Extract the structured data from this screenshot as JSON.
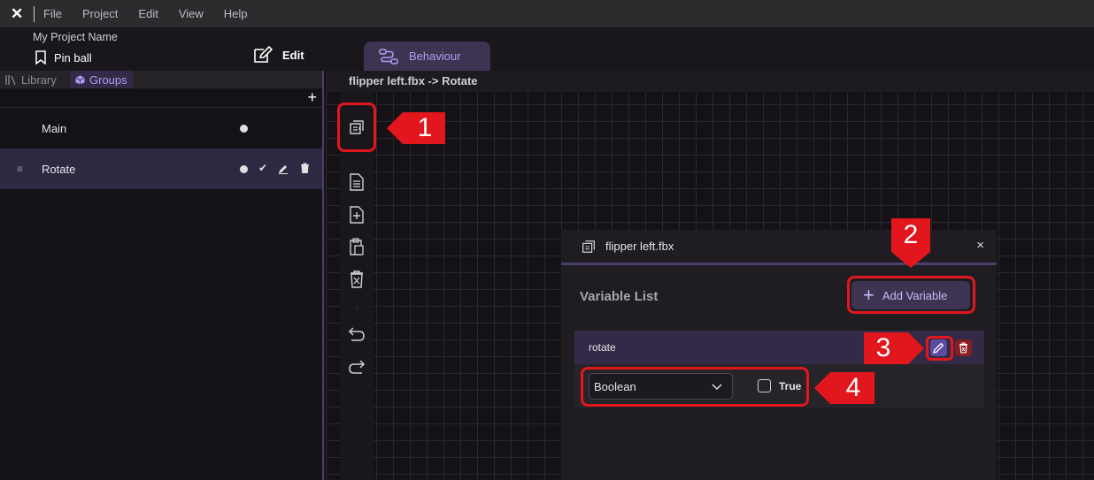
{
  "menu": {
    "logo_icon": "app-logo-icon",
    "items": [
      "File",
      "Project",
      "Edit",
      "View",
      "Help"
    ]
  },
  "header": {
    "project_name": "My Project Name",
    "file_name": "Pin ball",
    "edit_tab": "Edit",
    "behaviour_tab": "Behaviour"
  },
  "left_panel": {
    "tabs": {
      "library": "Library",
      "groups": "Groups"
    },
    "groups": [
      {
        "label": "Main"
      },
      {
        "label": "Rotate"
      }
    ]
  },
  "canvas": {
    "breadcrumb": "flipper left.fbx -> Rotate"
  },
  "dialog": {
    "title": "flipper left.fbx",
    "close_label": "×",
    "section_title": "Variable List",
    "add_variable_label": "Add Variable",
    "variable": {
      "name": "rotate",
      "type": "Boolean",
      "value_label": "True"
    }
  },
  "callouts": [
    "1",
    "2",
    "3",
    "4"
  ],
  "colors": {
    "accent": "#b29bf0",
    "annotation_red": "#e2171d",
    "selected_row": "#2f2842"
  }
}
